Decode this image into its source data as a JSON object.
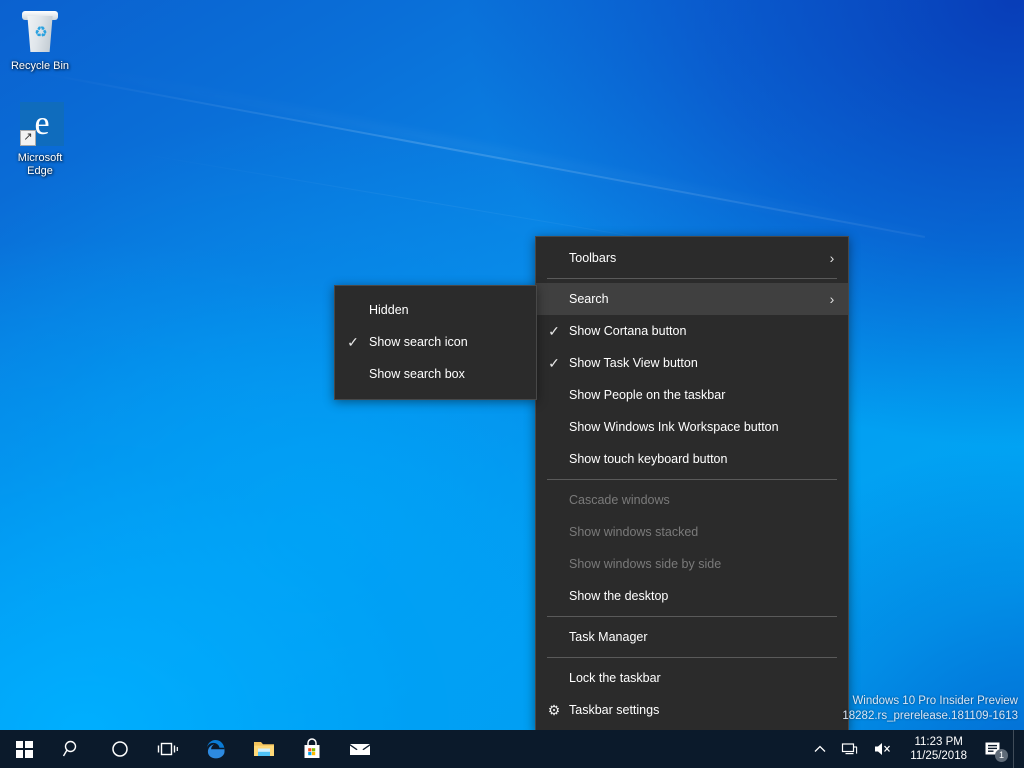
{
  "desktop": {
    "icons": [
      {
        "name": "recycle-bin",
        "label": "Recycle Bin"
      },
      {
        "name": "microsoft-edge",
        "label": "Microsoft\nEdge",
        "label_line1": "Microsoft",
        "label_line2": "Edge"
      }
    ]
  },
  "context_menu": {
    "title": "Taskbar context menu",
    "items": [
      {
        "label": "Toolbars",
        "submenu": true,
        "checked": false,
        "disabled": false,
        "selected": false,
        "icon": ""
      },
      {
        "label": "Search",
        "submenu": true,
        "checked": false,
        "disabled": false,
        "selected": true,
        "icon": ""
      },
      {
        "label": "Show Cortana button",
        "submenu": false,
        "checked": true,
        "disabled": false,
        "selected": false,
        "icon": ""
      },
      {
        "label": "Show Task View button",
        "submenu": false,
        "checked": true,
        "disabled": false,
        "selected": false,
        "icon": ""
      },
      {
        "label": "Show People on the taskbar",
        "submenu": false,
        "checked": false,
        "disabled": false,
        "selected": false,
        "icon": ""
      },
      {
        "label": "Show Windows Ink Workspace button",
        "submenu": false,
        "checked": false,
        "disabled": false,
        "selected": false,
        "icon": ""
      },
      {
        "label": "Show touch keyboard button",
        "submenu": false,
        "checked": false,
        "disabled": false,
        "selected": false,
        "icon": ""
      },
      {
        "label": "Cascade windows",
        "submenu": false,
        "checked": false,
        "disabled": true,
        "selected": false,
        "icon": ""
      },
      {
        "label": "Show windows stacked",
        "submenu": false,
        "checked": false,
        "disabled": true,
        "selected": false,
        "icon": ""
      },
      {
        "label": "Show windows side by side",
        "submenu": false,
        "checked": false,
        "disabled": true,
        "selected": false,
        "icon": ""
      },
      {
        "label": "Show the desktop",
        "submenu": false,
        "checked": false,
        "disabled": false,
        "selected": false,
        "icon": ""
      },
      {
        "label": "Task Manager",
        "submenu": false,
        "checked": false,
        "disabled": false,
        "selected": false,
        "icon": ""
      },
      {
        "label": "Lock the taskbar",
        "submenu": false,
        "checked": false,
        "disabled": false,
        "selected": false,
        "icon": ""
      },
      {
        "label": "Taskbar settings",
        "submenu": false,
        "checked": false,
        "disabled": false,
        "selected": false,
        "icon": "gear-icon"
      }
    ]
  },
  "search_submenu": {
    "items": [
      {
        "label": "Hidden",
        "checked": false
      },
      {
        "label": "Show search icon",
        "checked": true
      },
      {
        "label": "Show search box",
        "checked": false
      }
    ]
  },
  "watermark": {
    "line1": "Windows 10 Pro Insider Preview",
    "line2": "18282.rs_prerelease.181109-1613"
  },
  "taskbar": {
    "buttons": [
      {
        "name": "start-button",
        "icon": "windows-logo-icon",
        "label": "Start"
      },
      {
        "name": "search-button",
        "icon": "search-icon",
        "label": "Search"
      },
      {
        "name": "cortana-button",
        "icon": "cortana-circle-icon",
        "label": "Cortana"
      },
      {
        "name": "task-view-button",
        "icon": "task-view-icon",
        "label": "Task View"
      },
      {
        "name": "edge-button",
        "icon": "edge-icon",
        "label": "Microsoft Edge"
      },
      {
        "name": "file-explorer-button",
        "icon": "folder-icon",
        "label": "File Explorer"
      },
      {
        "name": "microsoft-store-button",
        "icon": "store-bag-icon",
        "label": "Microsoft Store"
      },
      {
        "name": "mail-button",
        "icon": "mail-envelope-icon",
        "label": "Mail"
      }
    ],
    "tray": {
      "overflow_icon": "chevron-up-icon",
      "network_icon": "network-icon",
      "volume_icon": "volume-muted-icon",
      "clock_time": "11:23 PM",
      "clock_date": "11/25/2018",
      "action_center_icon": "action-center-icon",
      "action_center_count": "1"
    }
  },
  "colors": {
    "menu_bg": "#2b2b2b",
    "menu_border": "#484848",
    "menu_selected": "#404040",
    "menu_separator": "#5a5a5a",
    "menu_text": "#ffffff",
    "menu_disabled_text": "#7a7a7a",
    "taskbar_bg": "#0b1a2b",
    "desktop_blue": "#0a6fd8",
    "desktop_cyan": "#00a6f4",
    "watermark_text": "#d9e6f7"
  }
}
